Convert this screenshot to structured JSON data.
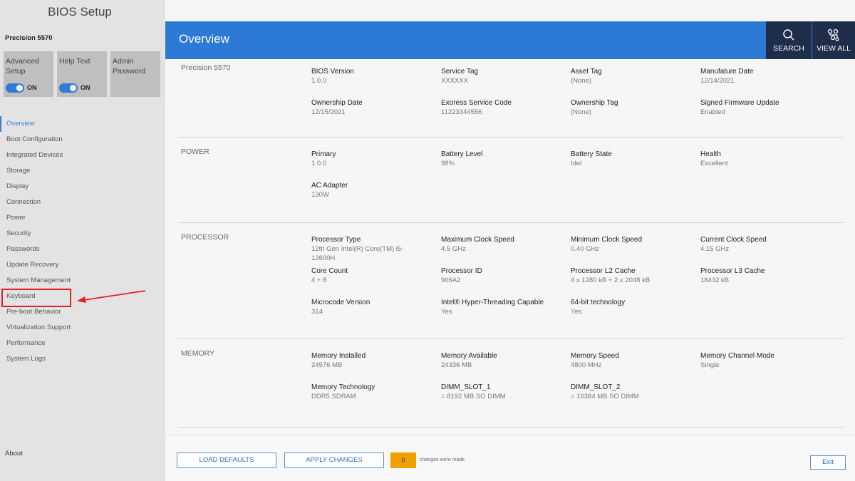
{
  "sidebar": {
    "title": "BIOS Setup",
    "model": "Precision 5570",
    "tiles": [
      {
        "label": "Advanced\nSetup",
        "toggle": "ON"
      },
      {
        "label": "Help Text",
        "toggle": "ON"
      },
      {
        "label": "Admin\nPassword"
      }
    ],
    "nav": [
      "Overview",
      "Boot Configuration",
      "Integrated Devices",
      "Storage",
      "Display",
      "Connection",
      "Power",
      "Security",
      "Passwords",
      "Update Recovery",
      "System Management",
      "Keyboard",
      "Pre-boot Behavior",
      "Virtualization Support",
      "Performance",
      "System Logs"
    ],
    "active_item": "Overview",
    "about": "About"
  },
  "header": {
    "title": "Overview",
    "search_label": "SEARCH",
    "view_all_label": "VIEW ALL"
  },
  "sections": [
    {
      "label": "Precision 5570",
      "fields": [
        {
          "label": "BIOS Version",
          "value": "1.0.0"
        },
        {
          "label": "Service Tag",
          "value": "XXXXXX"
        },
        {
          "label": "Asset Tag",
          "value": "(None)"
        },
        {
          "label": "Manufature Date",
          "value": "12/14/2021"
        },
        {
          "label": "Ownership Date",
          "value": "12/15/2021"
        },
        {
          "label": "Exoress Service Code",
          "value": "11223344556"
        },
        {
          "label": "Ownership Tag",
          "value": "(None)"
        },
        {
          "label": "Signed Firmware Update",
          "value": "Enabled"
        }
      ]
    },
    {
      "label": "POWER",
      "fields": [
        {
          "label": "Primary",
          "value": "1.0.0"
        },
        {
          "label": "Battery Level",
          "value": "98%"
        },
        {
          "label": "Battery State",
          "value": "Idel"
        },
        {
          "label": "Health",
          "value": "Excellent"
        },
        {
          "label": "AC Adapter",
          "value": "130W"
        }
      ]
    },
    {
      "label": "PROCESSOR",
      "fields": [
        {
          "label": "Processor Type",
          "value": "12th Gen Intel(R) Core(TM) i5-12600H"
        },
        {
          "label": "Maximum Clock Speed",
          "value": "4.5 GHz"
        },
        {
          "label": "Minimum Clock Speed",
          "value": "0.40 GHz"
        },
        {
          "label": "Current Clock Speed",
          "value": "4.15 GHz"
        },
        {
          "label": "Core Count",
          "value": "4 + 8"
        },
        {
          "label": "Processor ID",
          "value": "906A2"
        },
        {
          "label": "Processor L2 Cache",
          "value": "4 x 1280 kB + 2 x 2048 kB"
        },
        {
          "label": "Processor L3 Cache",
          "value": "18432 kB"
        },
        {
          "label": "Microcode Version",
          "value": "314"
        },
        {
          "label": "Intel® Hyper-Threading Capable",
          "value": "Yes"
        },
        {
          "label": "64-bit technology",
          "value": "Yes"
        }
      ]
    },
    {
      "label": "MEMORY",
      "fields": [
        {
          "label": "Memory Installed",
          "value": "24576 MB"
        },
        {
          "label": "Memory Available",
          "value": "24336 MB"
        },
        {
          "label": "Memory Speed",
          "value": "4800 MHz"
        },
        {
          "label": "Memory Channel Mode",
          "value": "Single"
        },
        {
          "label": "Memory Technology",
          "value": "DDR5 SDRAM"
        },
        {
          "label": "DIMM_SLOT_1",
          "value": "= 8192 MB SO DIMM"
        },
        {
          "label": "DIMM_SLOT_2",
          "value": "= 16384 MB SO DIMM"
        }
      ]
    }
  ],
  "footer": {
    "load_defaults": "LOAD DEFAULTS",
    "apply_changes": "APPLY CHANGES",
    "changes_count": "0",
    "changes_text": "changes were made",
    "exit": "Exit"
  },
  "colors": {
    "header_blue": "#2d7ad6",
    "header_dark": "#1e2e4a",
    "annotation_red": "#e02020",
    "changes_badge": "#f0a000"
  }
}
